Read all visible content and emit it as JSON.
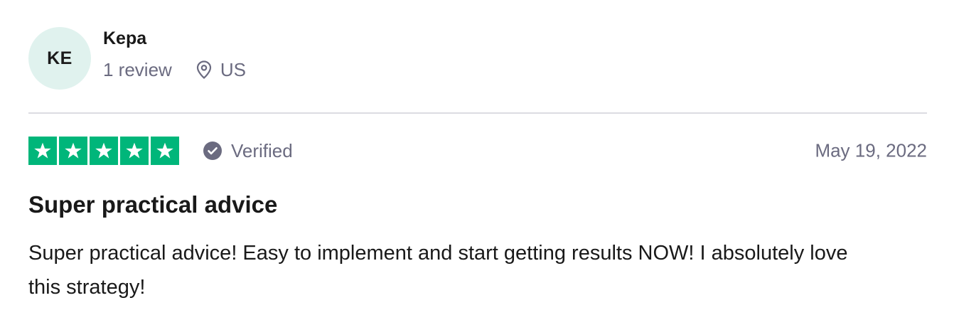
{
  "reviewer": {
    "initials": "KE",
    "name": "Kepa",
    "review_count": "1 review",
    "location": "US",
    "location_icon": "location-pin-icon"
  },
  "review": {
    "rating": 5,
    "rating_max": 5,
    "star_color": "#00b67a",
    "verified_label": "Verified",
    "verified_icon": "check-circle-icon",
    "date": "May 19, 2022",
    "title": "Super practical advice",
    "body": "Super practical advice! Easy to implement and start getting results NOW! I absolutely love this strategy!"
  }
}
